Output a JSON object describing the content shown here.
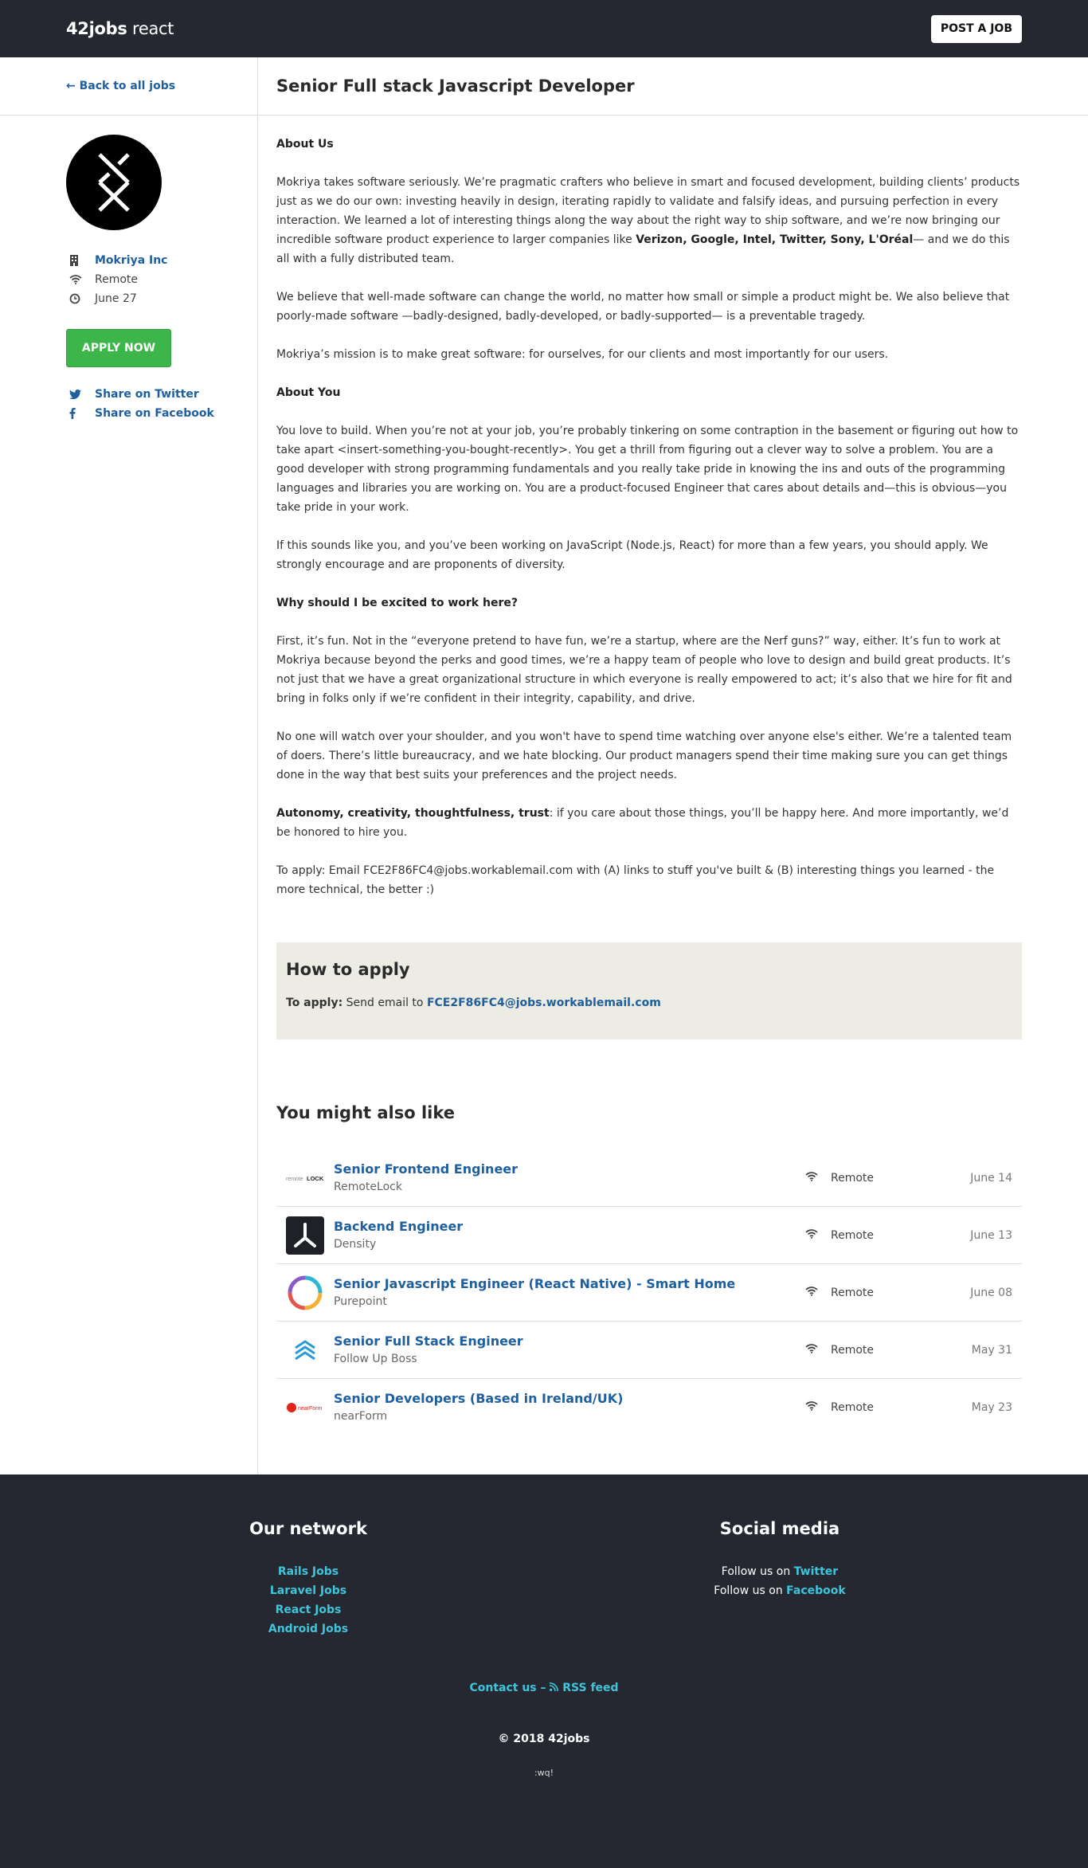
{
  "header": {
    "logo_bold": "42jobs",
    "logo_light": "react",
    "post_button": "POST A JOB"
  },
  "sidebar": {
    "back_link": "← Back to all jobs",
    "company": "Mokriya Inc",
    "location": "Remote",
    "date": "June 27",
    "apply_button": "APPLY NOW",
    "share_twitter": "Share on Twitter",
    "share_facebook": "Share on Facebook"
  },
  "job": {
    "title": "Senior Full stack Javascript Developer",
    "h_about_us": "About Us",
    "p1_a": "Mokriya takes software seriously. We’re pragmatic crafters who believe in smart and focused development, building clients’ products just as we do our own: investing heavily in design, iterating rapidly to validate and falsify ideas, and pursuing perfection in every interaction. We learned a lot of interesting things along the way about the right way to ship software, and we’re now bringing our incredible software product experience to larger companies like ",
    "p1_b": "Verizon, Google, Intel, Twitter, Sony, L'Oréal",
    "p1_c": "— and we do this all with a fully distributed team.",
    "p2": "We believe that well-made software can change the world, no matter how small or simple a product might be. We also believe that poorly-made software —badly-designed, badly-developed, or badly-supported— is a preventable tragedy.",
    "p3": "Mokriya’s mission is to make great software: for ourselves, for our clients and most importantly for our users.",
    "h_about_you": "About You",
    "p4": "You love to build. When you’re not at your job, you’re probably tinkering on some contraption in the basement or figuring out how to take apart <insert-something-you-bought-recently>. You get a thrill from figuring out a clever way to solve a problem. You are a good developer with strong programming fundamentals and you really take pride in knowing the ins and outs of the programming languages and libraries you are working on. You are a product-focused Engineer that cares about details and—this is obvious—you take pride in your work.",
    "p5": "If this sounds like you, and you’ve been working on JavaScript (Node.js, React) for more than a few years, you should apply. We strongly encourage and are proponents of diversity.",
    "h_why": "Why should I be excited to work here?",
    "p6": "First, it’s fun. Not in the “everyone pretend to have fun, we’re a startup, where are the Nerf guns?” way, either. It’s fun to work at Mokriya because beyond the perks and good times, we’re a happy team of people who love to design and build great products. It’s not just that we have a great organizational structure in which everyone is really empowered to act; it’s also that we hire for fit and bring in folks only if we’re confident in their integrity, capability, and drive.",
    "p7": "No one will watch over your shoulder, and you won't have to spend time watching over anyone else's either. We’re a talented team of doers. There’s little bureaucracy, and we hate blocking. Our product managers spend their time making sure you can get things done in the way that best suits your preferences and the project needs.",
    "p8_bold": "Autonomy, creativity, thoughtfulness, trust",
    "p8_rest": ": if you care about those things, you’ll be happy here. And more importantly, we’d be honored to hire you.",
    "p9": "To apply: Email FCE2F86FC4@jobs.workablemail.com with (A) links to stuff you've built & (B) interesting things you learned - the more technical, the better :)"
  },
  "how_to_apply": {
    "heading": "How to apply",
    "label": "To apply:",
    "text": "Send email to",
    "email": "FCE2F86FC4@jobs.workablemail.com"
  },
  "related": {
    "heading": "You might also like",
    "jobs": [
      {
        "title": "Senior Frontend Engineer",
        "company": "RemoteLock",
        "location": "Remote",
        "date": "June 14"
      },
      {
        "title": "Backend Engineer",
        "company": "Density",
        "location": "Remote",
        "date": "June 13"
      },
      {
        "title": "Senior Javascript Engineer (React Native) - Smart Home",
        "company": "Purepoint",
        "location": "Remote",
        "date": "June 08"
      },
      {
        "title": "Senior Full Stack Engineer",
        "company": "Follow Up Boss",
        "location": "Remote",
        "date": "May 31"
      },
      {
        "title": "Senior Developers (Based in Ireland/UK)",
        "company": "nearForm",
        "location": "Remote",
        "date": "May 23"
      }
    ]
  },
  "footer": {
    "network_heading": "Our network",
    "network_links": [
      "Rails Jobs",
      "Laravel Jobs",
      "React Jobs",
      "Android Jobs"
    ],
    "social_heading": "Social media",
    "follow_prefix": "Follow us on",
    "twitter": "Twitter",
    "facebook": "Facebook",
    "contact": "Contact us",
    "separator": "–",
    "rss": "RSS feed",
    "copyright": "© 2018 42jobs",
    "wq": ":wq!"
  },
  "colors": {
    "header_bg": "#252830",
    "link": "#1f5f9e",
    "apply_green": "#3cb54a",
    "howto_bg": "#ecebe4",
    "footer_link": "#3ec5dc"
  }
}
